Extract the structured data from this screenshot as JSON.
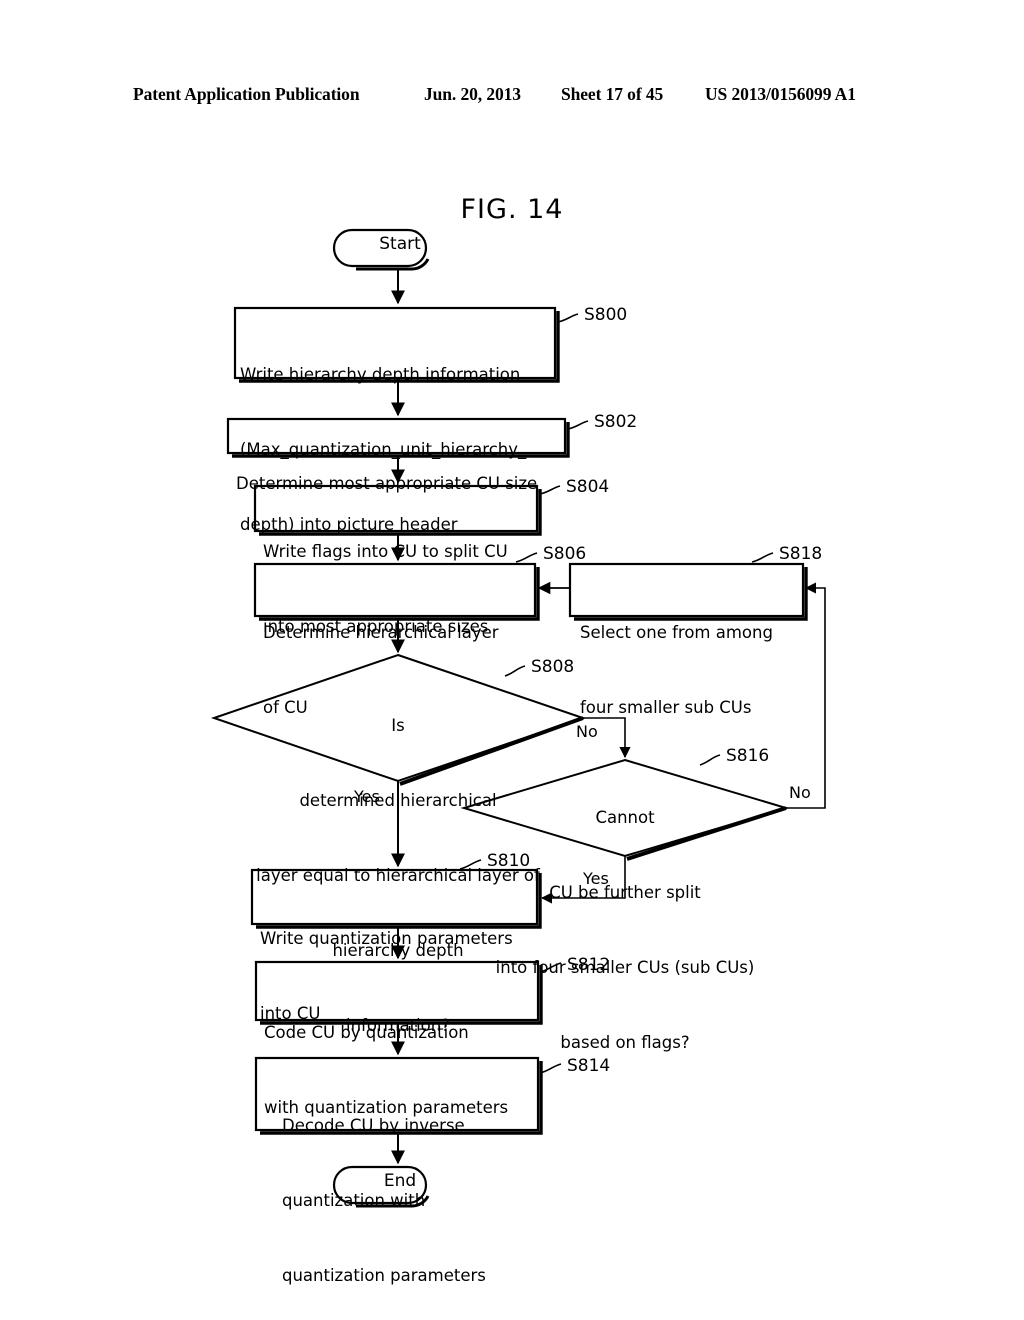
{
  "header": {
    "publication": "Patent Application Publication",
    "date": "Jun. 20, 2013",
    "sheet": "Sheet 17 of 45",
    "patent_number": "US 2013/0156099 A1"
  },
  "figure": {
    "title": "FIG. 14"
  },
  "flowchart": {
    "start_label": "Start",
    "end_label": "End",
    "nodes": [
      {
        "id": "S800",
        "tag": "S800",
        "shape": "process",
        "lines": [
          "Write hierarchy depth information",
          "(Max_quantization_unit_hierarchy_",
          "depth) into picture header"
        ]
      },
      {
        "id": "S802",
        "tag": "S802",
        "shape": "process",
        "lines": [
          "Determine most appropriate CU size"
        ]
      },
      {
        "id": "S804",
        "tag": "S804",
        "shape": "process",
        "lines": [
          "Write flags into CU to split CU",
          "into most appropriate sizes"
        ]
      },
      {
        "id": "S806",
        "tag": "S806",
        "shape": "process",
        "lines": [
          "Determine hierarchical layer",
          "of CU"
        ]
      },
      {
        "id": "S818",
        "tag": "S818",
        "shape": "process",
        "lines": [
          "Select one from among",
          "four smaller sub CUs"
        ]
      },
      {
        "id": "S808",
        "tag": "S808",
        "shape": "decision",
        "lines": [
          "Is",
          "determined hierarchical",
          "layer equal to hierarchical layer of",
          "hierarchy depth",
          "information?"
        ]
      },
      {
        "id": "S816",
        "tag": "S816",
        "shape": "decision",
        "lines": [
          "Cannot",
          "CU be further split",
          "into four smaller CUs (sub CUs)",
          "based on flags?"
        ]
      },
      {
        "id": "S810",
        "tag": "S810",
        "shape": "process",
        "lines": [
          "Write quantization parameters",
          "into CU"
        ]
      },
      {
        "id": "S812",
        "tag": "S812",
        "shape": "process",
        "lines": [
          "Code CU by quantization",
          "with quantization parameters"
        ]
      },
      {
        "id": "S814",
        "tag": "S814",
        "shape": "process",
        "lines": [
          "Decode CU by inverse",
          "quantization with",
          "quantization parameters"
        ]
      }
    ],
    "branch_labels": {
      "s808_no": "No",
      "s808_yes": "Yes",
      "s816_no": "No",
      "s816_yes": "Yes"
    }
  },
  "colors": {
    "ink": "#000000",
    "paper": "#ffffff"
  }
}
